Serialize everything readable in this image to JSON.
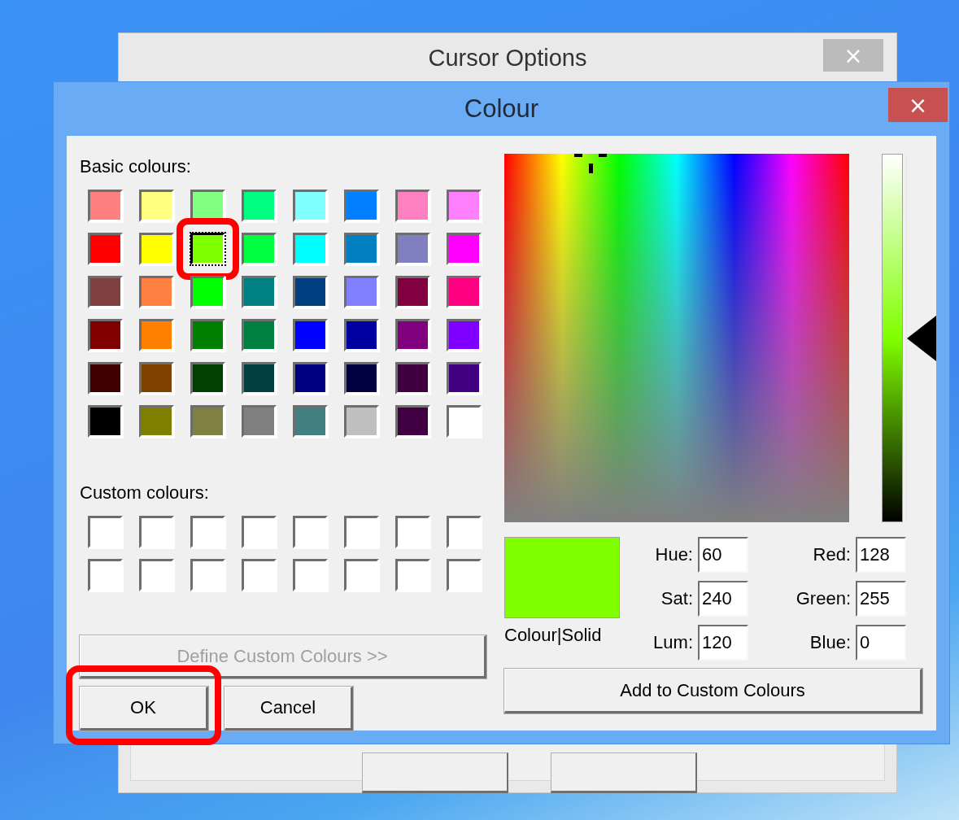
{
  "background_window": {
    "title": "Cursor Options",
    "close": "×"
  },
  "dialog": {
    "title": "Colour",
    "close": "×"
  },
  "basic_colours": {
    "label": "Basic colours:",
    "swatches": [
      {
        "color": "#ff8080",
        "selected": false,
        "highlighted": false
      },
      {
        "color": "#ffff80",
        "selected": false,
        "highlighted": false
      },
      {
        "color": "#80ff80",
        "selected": false,
        "highlighted": false
      },
      {
        "color": "#00ff80",
        "selected": false,
        "highlighted": false
      },
      {
        "color": "#80ffff",
        "selected": false,
        "highlighted": false
      },
      {
        "color": "#0080ff",
        "selected": false,
        "highlighted": false
      },
      {
        "color": "#ff80c0",
        "selected": false,
        "highlighted": false
      },
      {
        "color": "#ff80ff",
        "selected": false,
        "highlighted": false
      },
      {
        "color": "#ff0000",
        "selected": false,
        "highlighted": false
      },
      {
        "color": "#ffff00",
        "selected": false,
        "highlighted": false
      },
      {
        "color": "#80ff00",
        "selected": true,
        "highlighted": true
      },
      {
        "color": "#00ff40",
        "selected": false,
        "highlighted": false
      },
      {
        "color": "#00ffff",
        "selected": false,
        "highlighted": false
      },
      {
        "color": "#0080c0",
        "selected": false,
        "highlighted": false
      },
      {
        "color": "#8080c0",
        "selected": false,
        "highlighted": false
      },
      {
        "color": "#ff00ff",
        "selected": false,
        "highlighted": false
      },
      {
        "color": "#804040",
        "selected": false,
        "highlighted": false
      },
      {
        "color": "#ff8040",
        "selected": false,
        "highlighted": false
      },
      {
        "color": "#00ff00",
        "selected": false,
        "highlighted": false
      },
      {
        "color": "#008080",
        "selected": false,
        "highlighted": false
      },
      {
        "color": "#004080",
        "selected": false,
        "highlighted": false
      },
      {
        "color": "#8080ff",
        "selected": false,
        "highlighted": false
      },
      {
        "color": "#800040",
        "selected": false,
        "highlighted": false
      },
      {
        "color": "#ff0080",
        "selected": false,
        "highlighted": false
      },
      {
        "color": "#800000",
        "selected": false,
        "highlighted": false
      },
      {
        "color": "#ff8000",
        "selected": false,
        "highlighted": false
      },
      {
        "color": "#008000",
        "selected": false,
        "highlighted": false
      },
      {
        "color": "#008040",
        "selected": false,
        "highlighted": false
      },
      {
        "color": "#0000ff",
        "selected": false,
        "highlighted": false
      },
      {
        "color": "#0000a0",
        "selected": false,
        "highlighted": false
      },
      {
        "color": "#800080",
        "selected": false,
        "highlighted": false
      },
      {
        "color": "#8000ff",
        "selected": false,
        "highlighted": false
      },
      {
        "color": "#400000",
        "selected": false,
        "highlighted": false
      },
      {
        "color": "#804000",
        "selected": false,
        "highlighted": false
      },
      {
        "color": "#004000",
        "selected": false,
        "highlighted": false
      },
      {
        "color": "#004040",
        "selected": false,
        "highlighted": false
      },
      {
        "color": "#000080",
        "selected": false,
        "highlighted": false
      },
      {
        "color": "#000040",
        "selected": false,
        "highlighted": false
      },
      {
        "color": "#400040",
        "selected": false,
        "highlighted": false
      },
      {
        "color": "#400080",
        "selected": false,
        "highlighted": false
      },
      {
        "color": "#000000",
        "selected": false,
        "highlighted": false
      },
      {
        "color": "#808000",
        "selected": false,
        "highlighted": false
      },
      {
        "color": "#808040",
        "selected": false,
        "highlighted": false
      },
      {
        "color": "#808080",
        "selected": false,
        "highlighted": false
      },
      {
        "color": "#408080",
        "selected": false,
        "highlighted": false
      },
      {
        "color": "#c0c0c0",
        "selected": false,
        "highlighted": false
      },
      {
        "color": "#400041",
        "selected": false,
        "highlighted": false
      },
      {
        "color": "#ffffff",
        "selected": false,
        "highlighted": false
      }
    ]
  },
  "custom_colours": {
    "label": "Custom colours:",
    "swatches": [
      {
        "color": "#ffffff"
      },
      {
        "color": "#ffffff"
      },
      {
        "color": "#ffffff"
      },
      {
        "color": "#ffffff"
      },
      {
        "color": "#ffffff"
      },
      {
        "color": "#ffffff"
      },
      {
        "color": "#ffffff"
      },
      {
        "color": "#ffffff"
      },
      {
        "color": "#ffffff"
      },
      {
        "color": "#ffffff"
      },
      {
        "color": "#ffffff"
      },
      {
        "color": "#ffffff"
      },
      {
        "color": "#ffffff"
      },
      {
        "color": "#ffffff"
      },
      {
        "color": "#ffffff"
      },
      {
        "color": "#ffffff"
      }
    ]
  },
  "define_button": {
    "label": "Define Custom Colours >>",
    "disabled": true
  },
  "buttons": [
    {
      "label": "OK",
      "highlighted": true
    },
    {
      "label": "Cancel",
      "highlighted": false
    }
  ],
  "luminance_slider": {
    "level": 0.5
  },
  "preview": {
    "color": "#80ff00",
    "label": "Colour|Solid"
  },
  "fields_left": [
    {
      "label": "Hue:",
      "value": "60"
    },
    {
      "label": "Sat:",
      "value": "240"
    },
    {
      "label": "Lum:",
      "value": "120"
    }
  ],
  "fields_right": [
    {
      "label": "Red:",
      "value": "128"
    },
    {
      "label": "Green:",
      "value": "255"
    },
    {
      "label": "Blue:",
      "value": "0"
    }
  ],
  "add_button": {
    "label": "Add to Custom Colours"
  }
}
